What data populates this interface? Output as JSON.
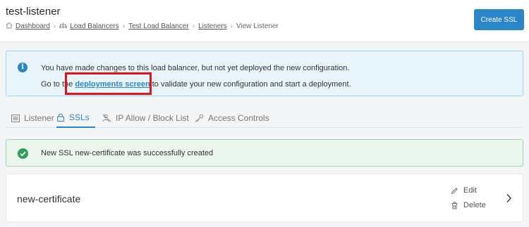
{
  "header": {
    "title": "test-listener",
    "create_button": "Create SSL",
    "breadcrumb": {
      "dashboard": "Dashboard",
      "load_balancers": "Load Balancers",
      "test_lb": "Test Load Balancer",
      "listeners": "Listeners",
      "current": "View Listener"
    }
  },
  "info_alert": {
    "line1": "You have made changes to this load balancer, but not yet deployed the new configuration.",
    "line2_prefix": "Go to the ",
    "link": "deployments screen",
    "line2_suffix": " to validate your new configuration and start a deployment."
  },
  "tabs": [
    {
      "label": "Listener",
      "icon": "list-icon"
    },
    {
      "label": "SSLs",
      "icon": "lock-icon",
      "active": true
    },
    {
      "label": "IP Allow / Block List",
      "icon": "block-user-icon"
    },
    {
      "label": "Access Controls",
      "icon": "key-icon"
    }
  ],
  "success_alert": {
    "text": "New SSL new-certificate was successfully created"
  },
  "certificate": {
    "name": "new-certificate",
    "edit": "Edit",
    "delete": "Delete"
  },
  "colors": {
    "primary": "#2b86c8",
    "success": "#2e9e5b",
    "highlight": "#e01414"
  }
}
